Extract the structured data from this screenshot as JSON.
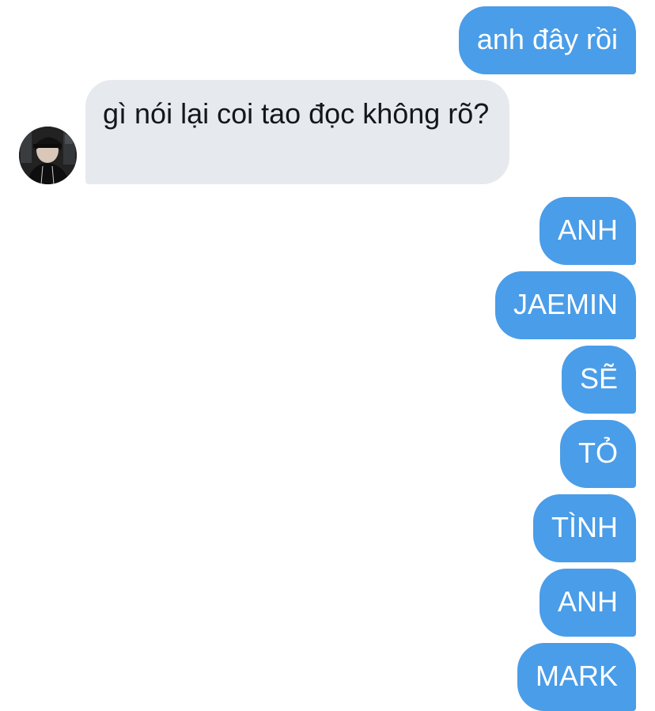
{
  "messages": [
    {
      "from": "me",
      "text": "anh đây rồi"
    },
    {
      "from": "them",
      "text": "gì nói lại coi tao đọc không rõ?"
    },
    {
      "from": "me",
      "text": "ANH"
    },
    {
      "from": "me",
      "text": "JAEMIN"
    },
    {
      "from": "me",
      "text": "SẼ"
    },
    {
      "from": "me",
      "text": "TỎ"
    },
    {
      "from": "me",
      "text": "TÌNH"
    },
    {
      "from": "me",
      "text": "ANH"
    },
    {
      "from": "me",
      "text": "MARK"
    }
  ],
  "colors": {
    "outgoing_bubble": "#4a9de8",
    "incoming_bubble": "#e6eaee",
    "outgoing_text": "#ffffff",
    "incoming_text": "#14171a"
  },
  "icons": {
    "contact_avatar": "avatar-photo"
  }
}
